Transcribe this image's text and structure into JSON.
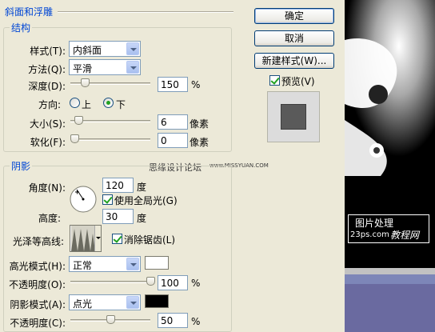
{
  "bevel": {
    "title": "斜面和浮雕",
    "structure_title": "结构",
    "style_label": "样式(T):",
    "style_value": "内斜面",
    "technique_label": "方法(Q):",
    "technique_value": "平滑",
    "depth_label": "深度(D):",
    "depth_value": "150",
    "depth_unit": "%",
    "direction_label": "方向:",
    "direction_up": "上",
    "direction_down": "下",
    "size_label": "大小(S):",
    "size_value": "6",
    "size_unit": "像素",
    "soften_label": "软化(F):",
    "soften_value": "0",
    "soften_unit": "像素"
  },
  "shading": {
    "title": "阴影",
    "angle_label": "角度(N):",
    "angle_value": "120",
    "angle_unit": "度",
    "global_light_label": "使用全局光(G)",
    "altitude_label": "高度:",
    "altitude_value": "30",
    "altitude_unit": "度",
    "gloss_label": "光泽等高线:",
    "antialias_label": "消除锯齿(L)",
    "highlight_mode_label": "高光模式(H):",
    "highlight_mode_value": "正常",
    "highlight_color": "#ffffff",
    "highlight_opacity_label": "不透明度(O):",
    "highlight_opacity_value": "100",
    "highlight_opacity_unit": "%",
    "shadow_mode_label": "阴影模式(A):",
    "shadow_mode_value": "点光",
    "shadow_color": "#000000",
    "shadow_opacity_label": "不透明度(C):",
    "shadow_opacity_value": "50",
    "shadow_opacity_unit": "%"
  },
  "watermark_text": "思缘设计论坛",
  "watermark_url": "www.MISSYUAN.COM",
  "buttons": {
    "ok": "确定",
    "cancel": "取消",
    "new_style": "新建样式(W)...",
    "preview": "预览(V)"
  },
  "preview_logo": {
    "line1": "图片处理",
    "line2": "23ps.com",
    "line3": "教程网"
  },
  "sliders": {
    "depth": 0.15,
    "size": 0.06,
    "soften": 0.0,
    "highlight_opacity": 1.0,
    "shadow_opacity": 0.5
  }
}
